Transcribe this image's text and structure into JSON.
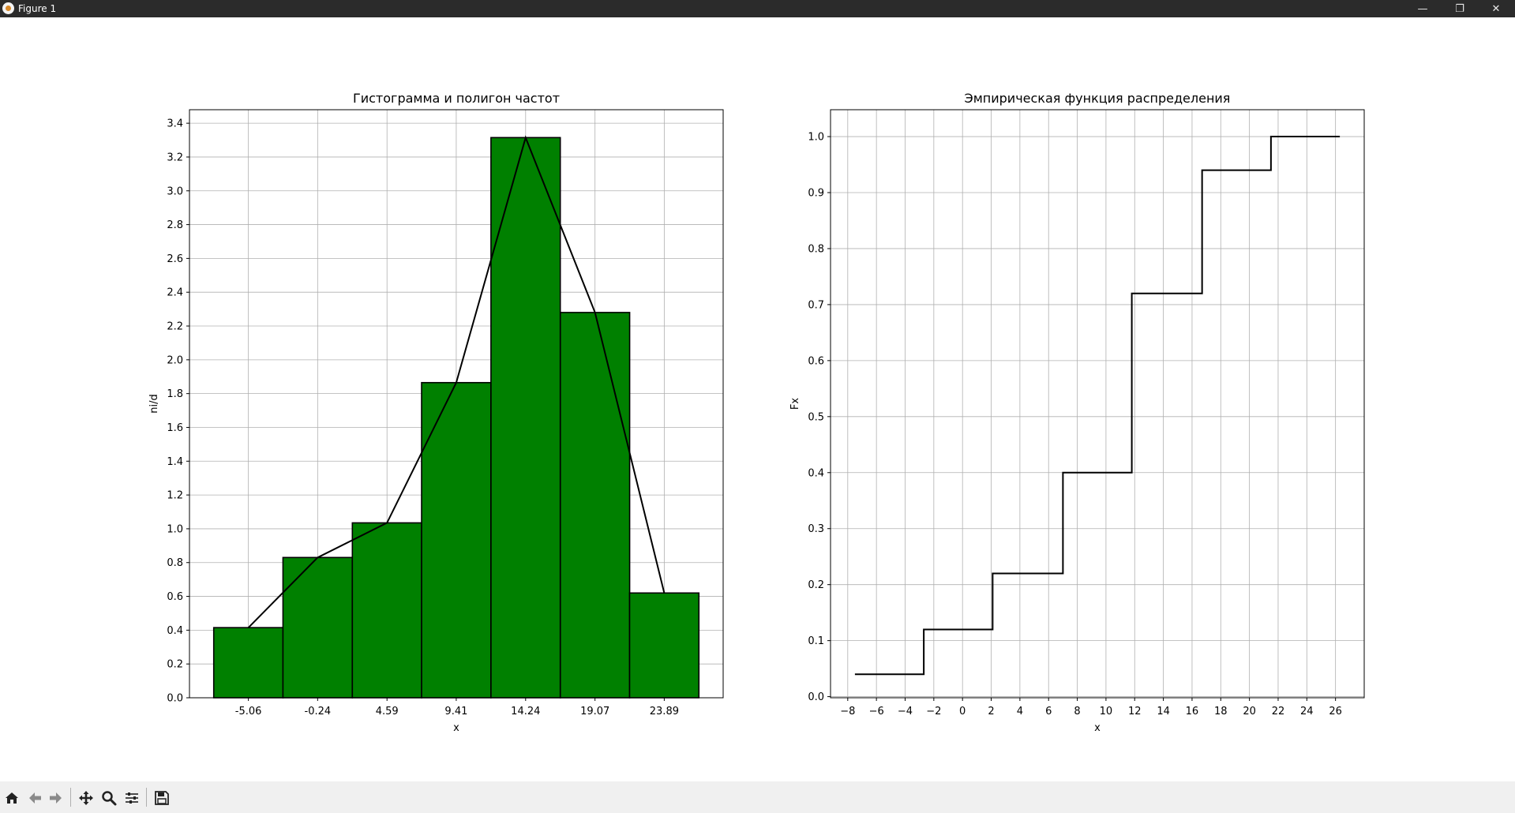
{
  "window": {
    "title": "Figure 1",
    "controls": [
      "—",
      "❐",
      "✕"
    ]
  },
  "chart_data": [
    {
      "type": "bar",
      "title": "Гистограмма и полигон частот",
      "xlabel": "x",
      "ylabel": "ni/d",
      "categories": [
        "-5.06",
        "-0.24",
        "4.59",
        "9.41",
        "14.24",
        "19.07",
        "23.89"
      ],
      "x": [
        -5.06,
        -0.24,
        4.59,
        9.41,
        14.24,
        19.07,
        23.89
      ],
      "values": [
        0.415,
        0.83,
        1.035,
        1.865,
        3.315,
        2.28,
        0.62
      ],
      "ylim": [
        0,
        3.48
      ],
      "yticks": [
        "0.0",
        "0.2",
        "0.4",
        "0.6",
        "0.8",
        "1.0",
        "1.2",
        "1.4",
        "1.6",
        "1.8",
        "2.0",
        "2.2",
        "2.4",
        "2.6",
        "2.8",
        "3.0",
        "3.2",
        "3.4"
      ],
      "grid": true,
      "bar_color": "#008000",
      "edge_color": "#000000",
      "polygon": {
        "x": [
          -5.06,
          -0.24,
          4.59,
          9.41,
          14.24,
          19.07,
          23.89
        ],
        "y": [
          0.415,
          0.83,
          1.035,
          1.865,
          3.315,
          2.28,
          0.62
        ],
        "color": "#000000"
      }
    },
    {
      "type": "line",
      "title": "Эмпирическая функция распределения",
      "xlabel": "x",
      "ylabel": "Fx",
      "step": [
        {
          "x1": -7.5,
          "x2": -2.7,
          "y": 0.04
        },
        {
          "x1": -2.7,
          "x2": 2.1,
          "y": 0.12
        },
        {
          "x1": 2.1,
          "x2": 7.0,
          "y": 0.22
        },
        {
          "x1": 7.0,
          "x2": 11.8,
          "y": 0.4
        },
        {
          "x1": 11.8,
          "x2": 16.7,
          "y": 0.72
        },
        {
          "x1": 16.7,
          "x2": 21.5,
          "y": 0.94
        },
        {
          "x1": 21.5,
          "x2": 26.3,
          "y": 1.0
        }
      ],
      "xlim": [
        -9.2,
        28.0
      ],
      "ylim": [
        -0.002,
        1.048
      ],
      "xticks": [
        {
          "v": -8,
          "label": "−8"
        },
        {
          "v": -6,
          "label": "−6"
        },
        {
          "v": -4,
          "label": "−4"
        },
        {
          "v": -2,
          "label": "−2"
        },
        {
          "v": 0,
          "label": "0"
        },
        {
          "v": 2,
          "label": "2"
        },
        {
          "v": 4,
          "label": "4"
        },
        {
          "v": 6,
          "label": "6"
        },
        {
          "v": 8,
          "label": "8"
        },
        {
          "v": 10,
          "label": "10"
        },
        {
          "v": 12,
          "label": "12"
        },
        {
          "v": 14,
          "label": "14"
        },
        {
          "v": 16,
          "label": "16"
        },
        {
          "v": 18,
          "label": "18"
        },
        {
          "v": 20,
          "label": "20"
        },
        {
          "v": 22,
          "label": "22"
        },
        {
          "v": 24,
          "label": "24"
        },
        {
          "v": 26,
          "label": "26"
        }
      ],
      "yticks": [
        "0.0",
        "0.1",
        "0.2",
        "0.3",
        "0.4",
        "0.5",
        "0.6",
        "0.7",
        "0.8",
        "0.9",
        "1.0"
      ],
      "grid": true,
      "line_color": "#000000"
    }
  ],
  "toolbar": [
    {
      "name": "home-icon"
    },
    {
      "name": "back-arrow-icon"
    },
    {
      "name": "forward-arrow-icon"
    },
    {
      "name": "pan-icon"
    },
    {
      "name": "zoom-icon"
    },
    {
      "name": "configure-subplots-icon"
    },
    {
      "name": "save-icon"
    }
  ]
}
